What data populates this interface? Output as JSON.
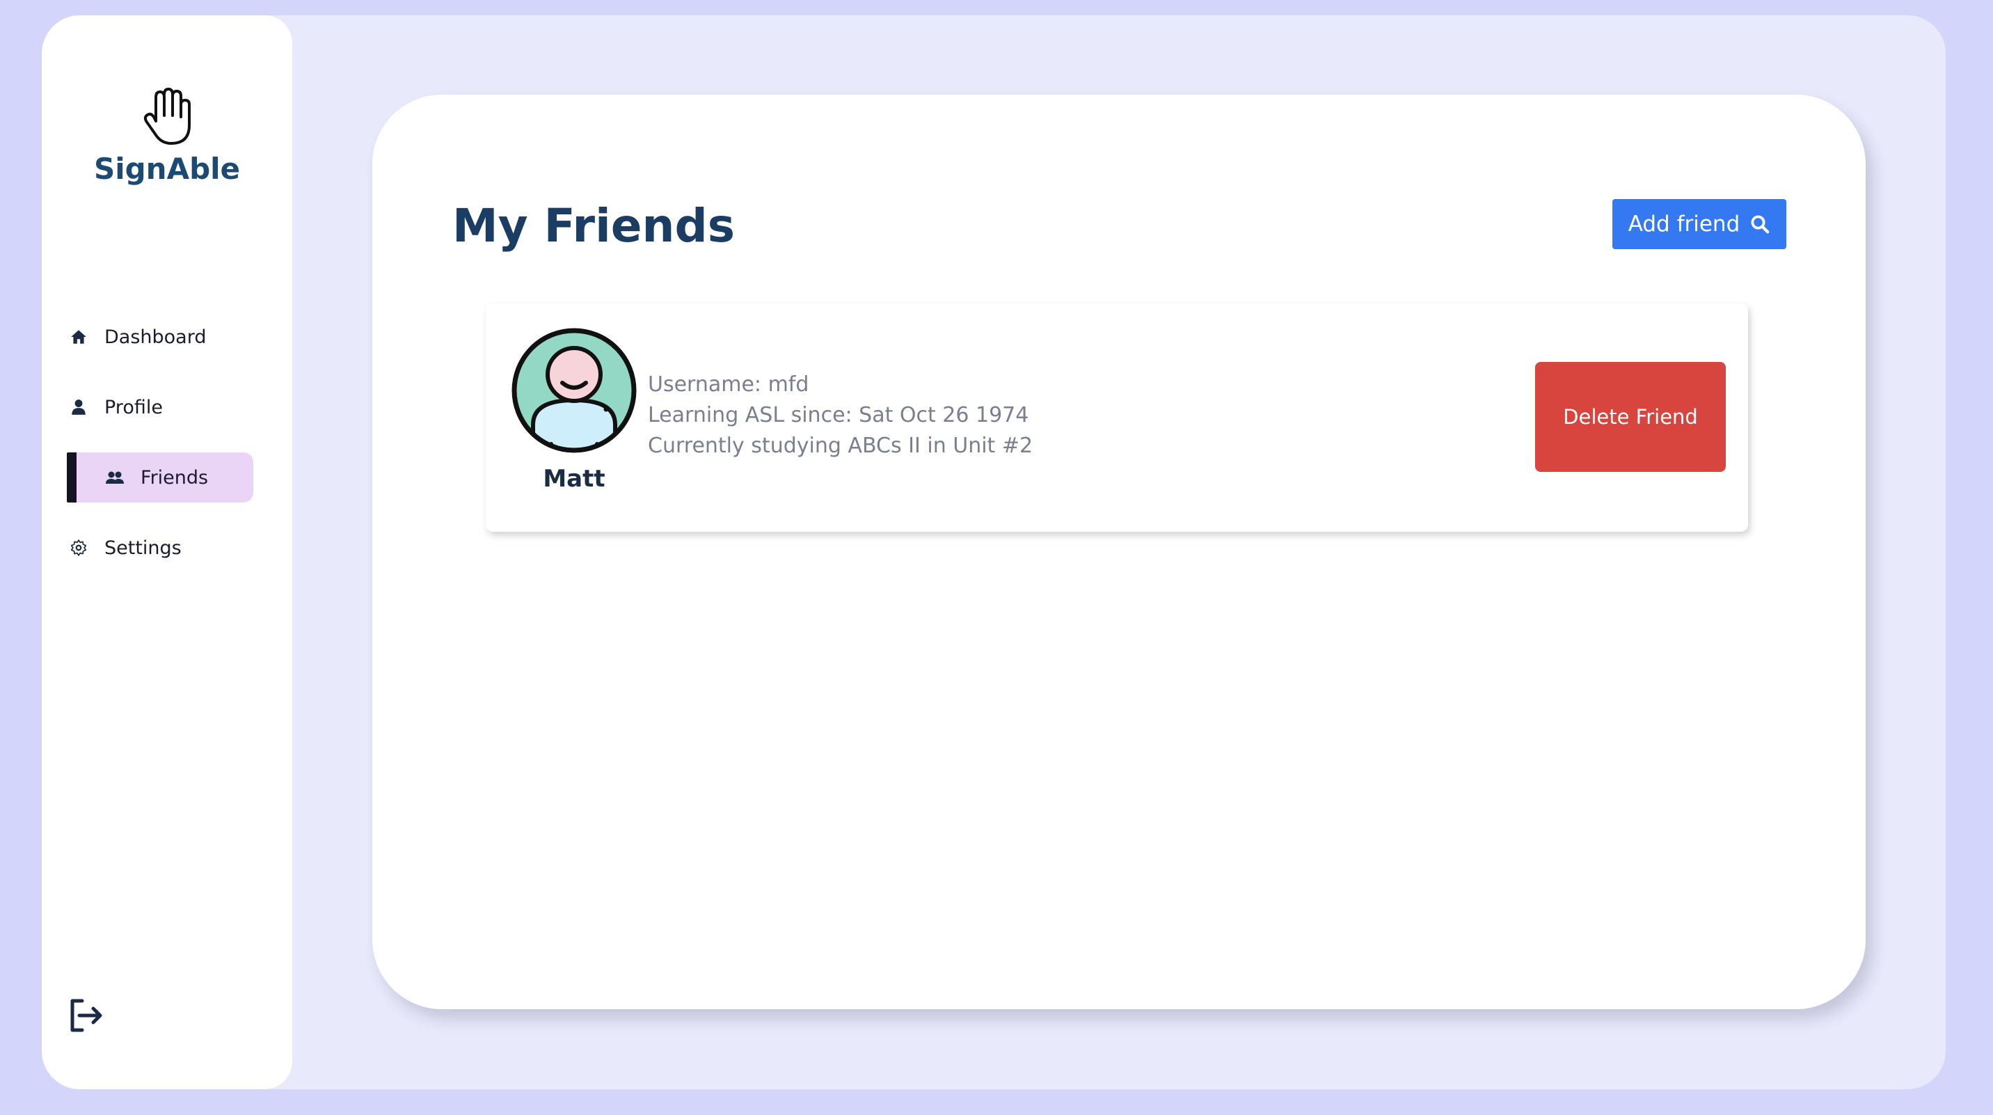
{
  "app": {
    "name": "SignAble",
    "colors": {
      "background": "#d3d6fa",
      "brand": "#1d4a72",
      "primary_button": "#3479f2",
      "danger_button": "#d8453f",
      "active_nav": "#ead5f7"
    }
  },
  "sidebar": {
    "logo_icon": "raised-hand-icon",
    "items": [
      {
        "label": "Dashboard",
        "icon": "home-icon",
        "active": false
      },
      {
        "label": "Profile",
        "icon": "user-icon",
        "active": false
      },
      {
        "label": "Friends",
        "icon": "users-icon",
        "active": true
      },
      {
        "label": "Settings",
        "icon": "gear-icon",
        "active": false
      }
    ],
    "logout_icon": "logout-icon"
  },
  "main": {
    "title": "My Friends",
    "add_friend_label": "Add friend",
    "add_friend_icon": "search-icon",
    "friends": [
      {
        "name": "Matt",
        "username": "Username: mfd",
        "learning_since": "Learning ASL since: Sat Oct 26 1974",
        "studying": "Currently studying ABCs II in Unit #2",
        "delete_label": "Delete Friend"
      }
    ]
  }
}
